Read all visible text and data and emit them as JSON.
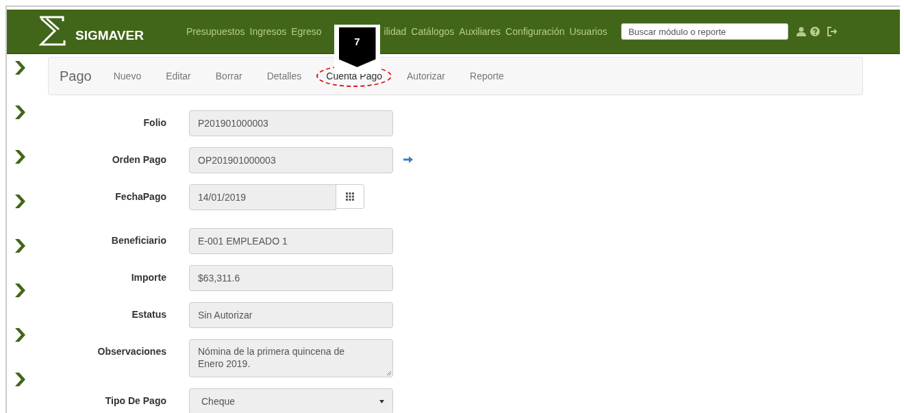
{
  "header": {
    "brand": "SIGMAVER",
    "nav": [
      "Presupuestos",
      "Ingresos",
      "Egreso",
      "ilidad",
      "Catálogos",
      "Auxiliares",
      "Configuración",
      "Usuarios"
    ],
    "search": {
      "placeholder": "Buscar módulo o reporte"
    }
  },
  "callout": {
    "number": "7"
  },
  "toolbar": {
    "title": "Pago",
    "actions": [
      {
        "label": "Nuevo",
        "highlighted": false
      },
      {
        "label": "Editar",
        "highlighted": false
      },
      {
        "label": "Borrar",
        "highlighted": false
      },
      {
        "label": "Detalles",
        "highlighted": false
      },
      {
        "label": "Cuenta Pago",
        "highlighted": true
      },
      {
        "label": "Autorizar",
        "highlighted": false
      },
      {
        "label": "Reporte",
        "highlighted": false
      }
    ]
  },
  "form": [
    {
      "label": "Folio",
      "kind": "text",
      "value": "P201901000003",
      "link": false
    },
    {
      "label": "Orden Pago",
      "kind": "text",
      "value": "OP201901000003",
      "link": true
    },
    {
      "label": "FechaPago",
      "kind": "date",
      "value": "14/01/2019",
      "link": false
    },
    {
      "label": "Beneficiario",
      "kind": "text",
      "value": "E-001 EMPLEADO 1",
      "link": false
    },
    {
      "label": "Importe",
      "kind": "text",
      "value": "$63,311.6",
      "link": false
    },
    {
      "label": "Estatus",
      "kind": "text",
      "value": "Sin Autorizar",
      "link": false
    },
    {
      "label": "Observaciones",
      "kind": "textarea",
      "value": "Nómina de la primera quincena de Enero 2019.",
      "link": false
    },
    {
      "label": "Tipo De Pago",
      "kind": "select",
      "value": "Cheque",
      "link": false
    }
  ]
}
